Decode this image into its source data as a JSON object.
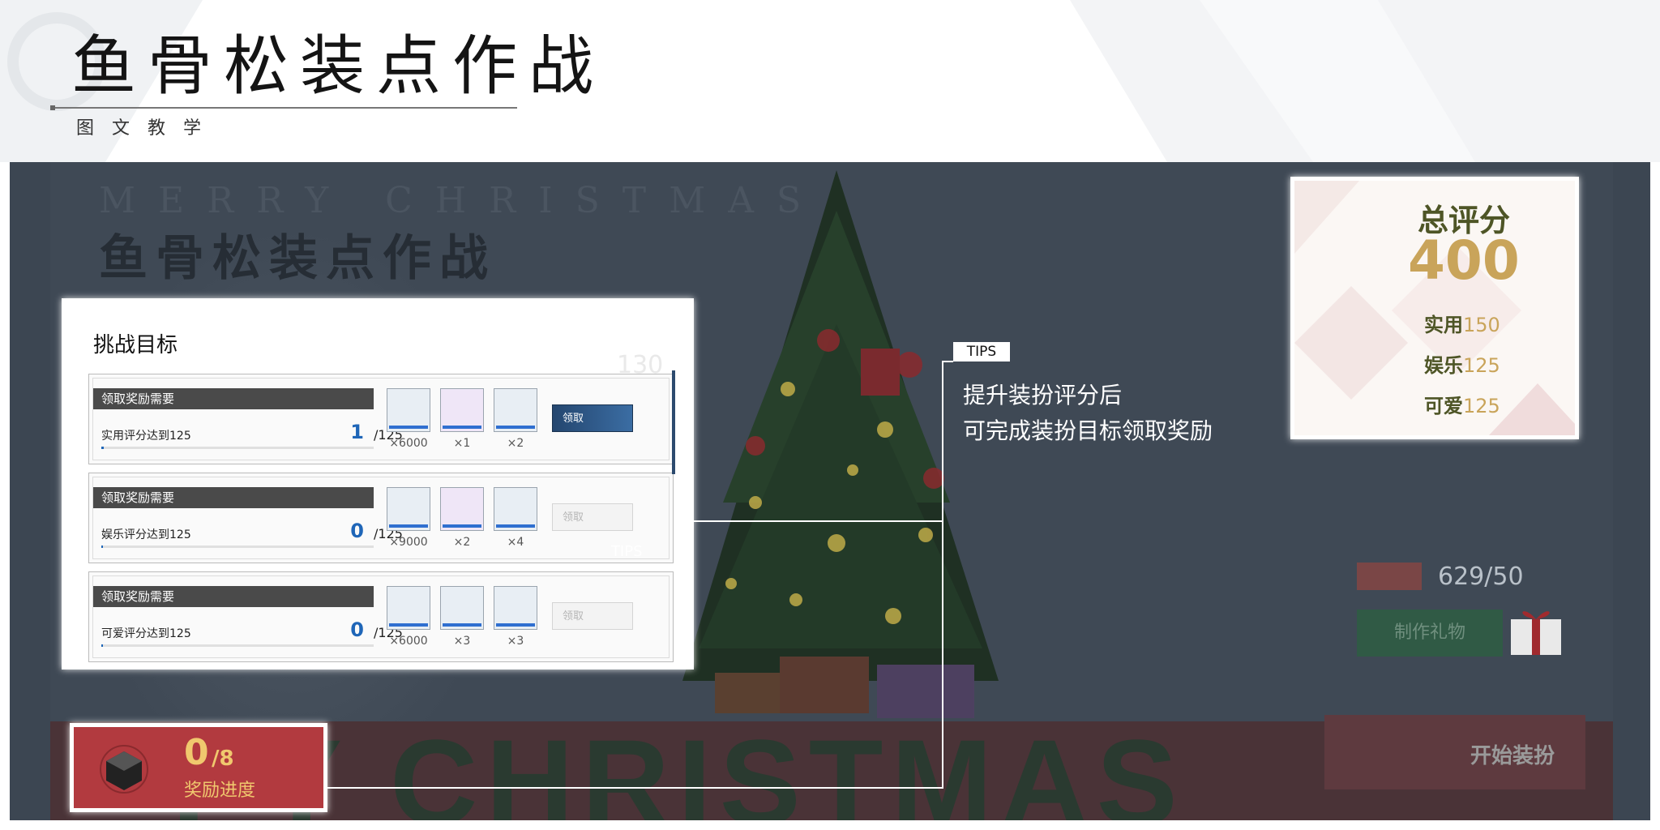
{
  "header": {
    "title": "鱼骨松装点作战",
    "subtitle": "图文教学"
  },
  "scene": {
    "merry_text": "MERRY CHRISTMAS",
    "game_title": "鱼骨松装点作战",
    "band_text": "PY CHRISTMAS"
  },
  "challenge": {
    "title": "挑战目标",
    "rows": [
      {
        "header": "领取奖励需要",
        "label": "实用评分达到125",
        "current": "1",
        "target": "/125",
        "progress": 0.008,
        "items": [
          {
            "icon": "ring-icon",
            "qty": "×6000"
          },
          {
            "icon": "capsule-icon",
            "qty": "×1"
          },
          {
            "icon": "chip-icon",
            "qty": "×2"
          }
        ],
        "claim_label": "领取",
        "claim_enabled": true
      },
      {
        "header": "领取奖励需要",
        "label": "娱乐评分达到125",
        "current": "0",
        "target": "/125",
        "progress": 0,
        "items": [
          {
            "icon": "ring-icon",
            "qty": "×9000"
          },
          {
            "icon": "capsule-icon",
            "qty": "×2"
          },
          {
            "icon": "chip-icon",
            "qty": "×4"
          }
        ],
        "claim_label": "领取",
        "claim_enabled": false
      },
      {
        "header": "领取奖励需要",
        "label": "可爱评分达到125",
        "current": "0",
        "target": "/125",
        "progress": 0,
        "items": [
          {
            "icon": "ring-icon",
            "qty": "×6000"
          },
          {
            "icon": "tool-icon",
            "qty": "×3"
          },
          {
            "icon": "wrench-icon",
            "qty": "×3"
          }
        ],
        "claim_label": "领取",
        "claim_enabled": false
      }
    ],
    "tips_small": "TIPS"
  },
  "total_score": {
    "label": "总评分",
    "value": "400",
    "stats": [
      {
        "key": "实用",
        "value": "150"
      },
      {
        "key": "娱乐",
        "value": "125"
      },
      {
        "key": "可爱",
        "value": "125"
      }
    ]
  },
  "tips": {
    "tag": "TIPS",
    "line1": "提升装扮评分后",
    "line2": "可完成装扮目标领取奖励"
  },
  "gift": {
    "counter": "629/50",
    "make_label": "制作礼物"
  },
  "start_dress": {
    "label": "开始装扮"
  },
  "reward": {
    "current": "0",
    "total": "/8",
    "label": "奖励进度"
  },
  "colors": {
    "accent_gold": "#c9a45a",
    "accent_olive": "#4e5526",
    "progress_blue": "#1f66b8",
    "reward_red": "#b23a3f"
  }
}
